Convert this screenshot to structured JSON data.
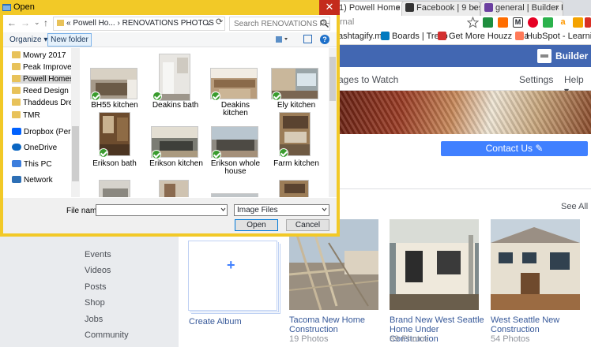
{
  "browser": {
    "tabs": [
      {
        "label": "1) Powell Home",
        "icon_color": "#4267b2",
        "active": true
      },
      {
        "label": "Facebook | 9 best",
        "icon_color": "#333333",
        "active": false
      },
      {
        "label": "general | Builder F",
        "icon_color": "#6b3fa0",
        "active": false
      }
    ],
    "tab_close_glyph": "×",
    "extensions": [
      "star-icon",
      "drive-icon",
      "bookmark-icon",
      "pinterest-icon",
      "m-icon",
      "amazon-icon",
      "feedly-icon",
      "flag-icon"
    ],
    "bookmarks": [
      {
        "label": "ashtagify.me",
        "icon_color": ""
      },
      {
        "label": "Boards | Trello",
        "icon_color": "#0079bf"
      },
      {
        "label": "Get More Houzz Lea",
        "icon_color": "#d32f2f"
      },
      {
        "label": "HubSpot - Learning C",
        "icon_color": "#ff7a59"
      }
    ]
  },
  "facebook": {
    "profile_name": "Builder Funn",
    "nav": {
      "pages_to_watch": "ages to Watch",
      "settings": "Settings",
      "help": "Help ▾"
    },
    "contact_button": "Contact Us ✎",
    "see_all": "See All",
    "left_links": [
      "Events",
      "Videos",
      "Posts",
      "Shop",
      "Jobs",
      "Community"
    ],
    "create_album": {
      "plus": "+",
      "label": "Create Album"
    },
    "albums": [
      {
        "title": "Tacoma New Home Construction",
        "count": "19 Photos"
      },
      {
        "title": "Brand New West Seattle Home Under Construction",
        "count": "89 Photos"
      },
      {
        "title": "West Seattle New Construction",
        "count": "54 Photos"
      }
    ]
  },
  "dialog": {
    "title": "Open",
    "close_glyph": "✕",
    "nav_back": "←",
    "nav_forward": "→",
    "nav_recent": "⌄",
    "nav_up": "↑",
    "address": {
      "prefix": "«",
      "parent": "Powell Ho...",
      "separator": "›",
      "current": "RENOVATIONS PHOTOS",
      "dropdown": "⌄"
    },
    "refresh_glyph": "⟳",
    "search_placeholder": "Search RENOVATIONS PHOTOS",
    "organize": "Organize ▾",
    "new_folder": "New folder",
    "help_glyph": "?",
    "tree": [
      {
        "label": "Mowry 2017",
        "selected": false
      },
      {
        "label": "Peak Improveme",
        "selected": false
      },
      {
        "label": "Powell Homes",
        "selected": true
      },
      {
        "label": "Reed Design Bui",
        "selected": false
      },
      {
        "label": "Thaddeus Drew",
        "selected": false
      },
      {
        "label": "TMR",
        "selected": false
      }
    ],
    "tree_roots": [
      {
        "label": "Dropbox (Persona",
        "icon_color": "#0061fe"
      },
      {
        "label": "OneDrive",
        "icon_color": "#0a66c2"
      },
      {
        "label": "This PC",
        "icon_color": "#3b7ddd"
      },
      {
        "label": "Network",
        "icon_color": "#2d6fb5"
      }
    ],
    "files": [
      {
        "name": "BH55 kitchen"
      },
      {
        "name": "Deakins bath"
      },
      {
        "name": "Deakins kitchen"
      },
      {
        "name": "Ely kitchen"
      },
      {
        "name": "Erikson bath"
      },
      {
        "name": "Erikson kitchen"
      },
      {
        "name": "Erikson whole house"
      },
      {
        "name": "Farm kitchen"
      },
      {
        "name": ""
      },
      {
        "name": ""
      },
      {
        "name": ""
      },
      {
        "name": ""
      }
    ],
    "filename_label": "File name:",
    "filename_value": "",
    "filetype": "Image Files",
    "open_button": "Open",
    "cancel_button": "Cancel"
  }
}
